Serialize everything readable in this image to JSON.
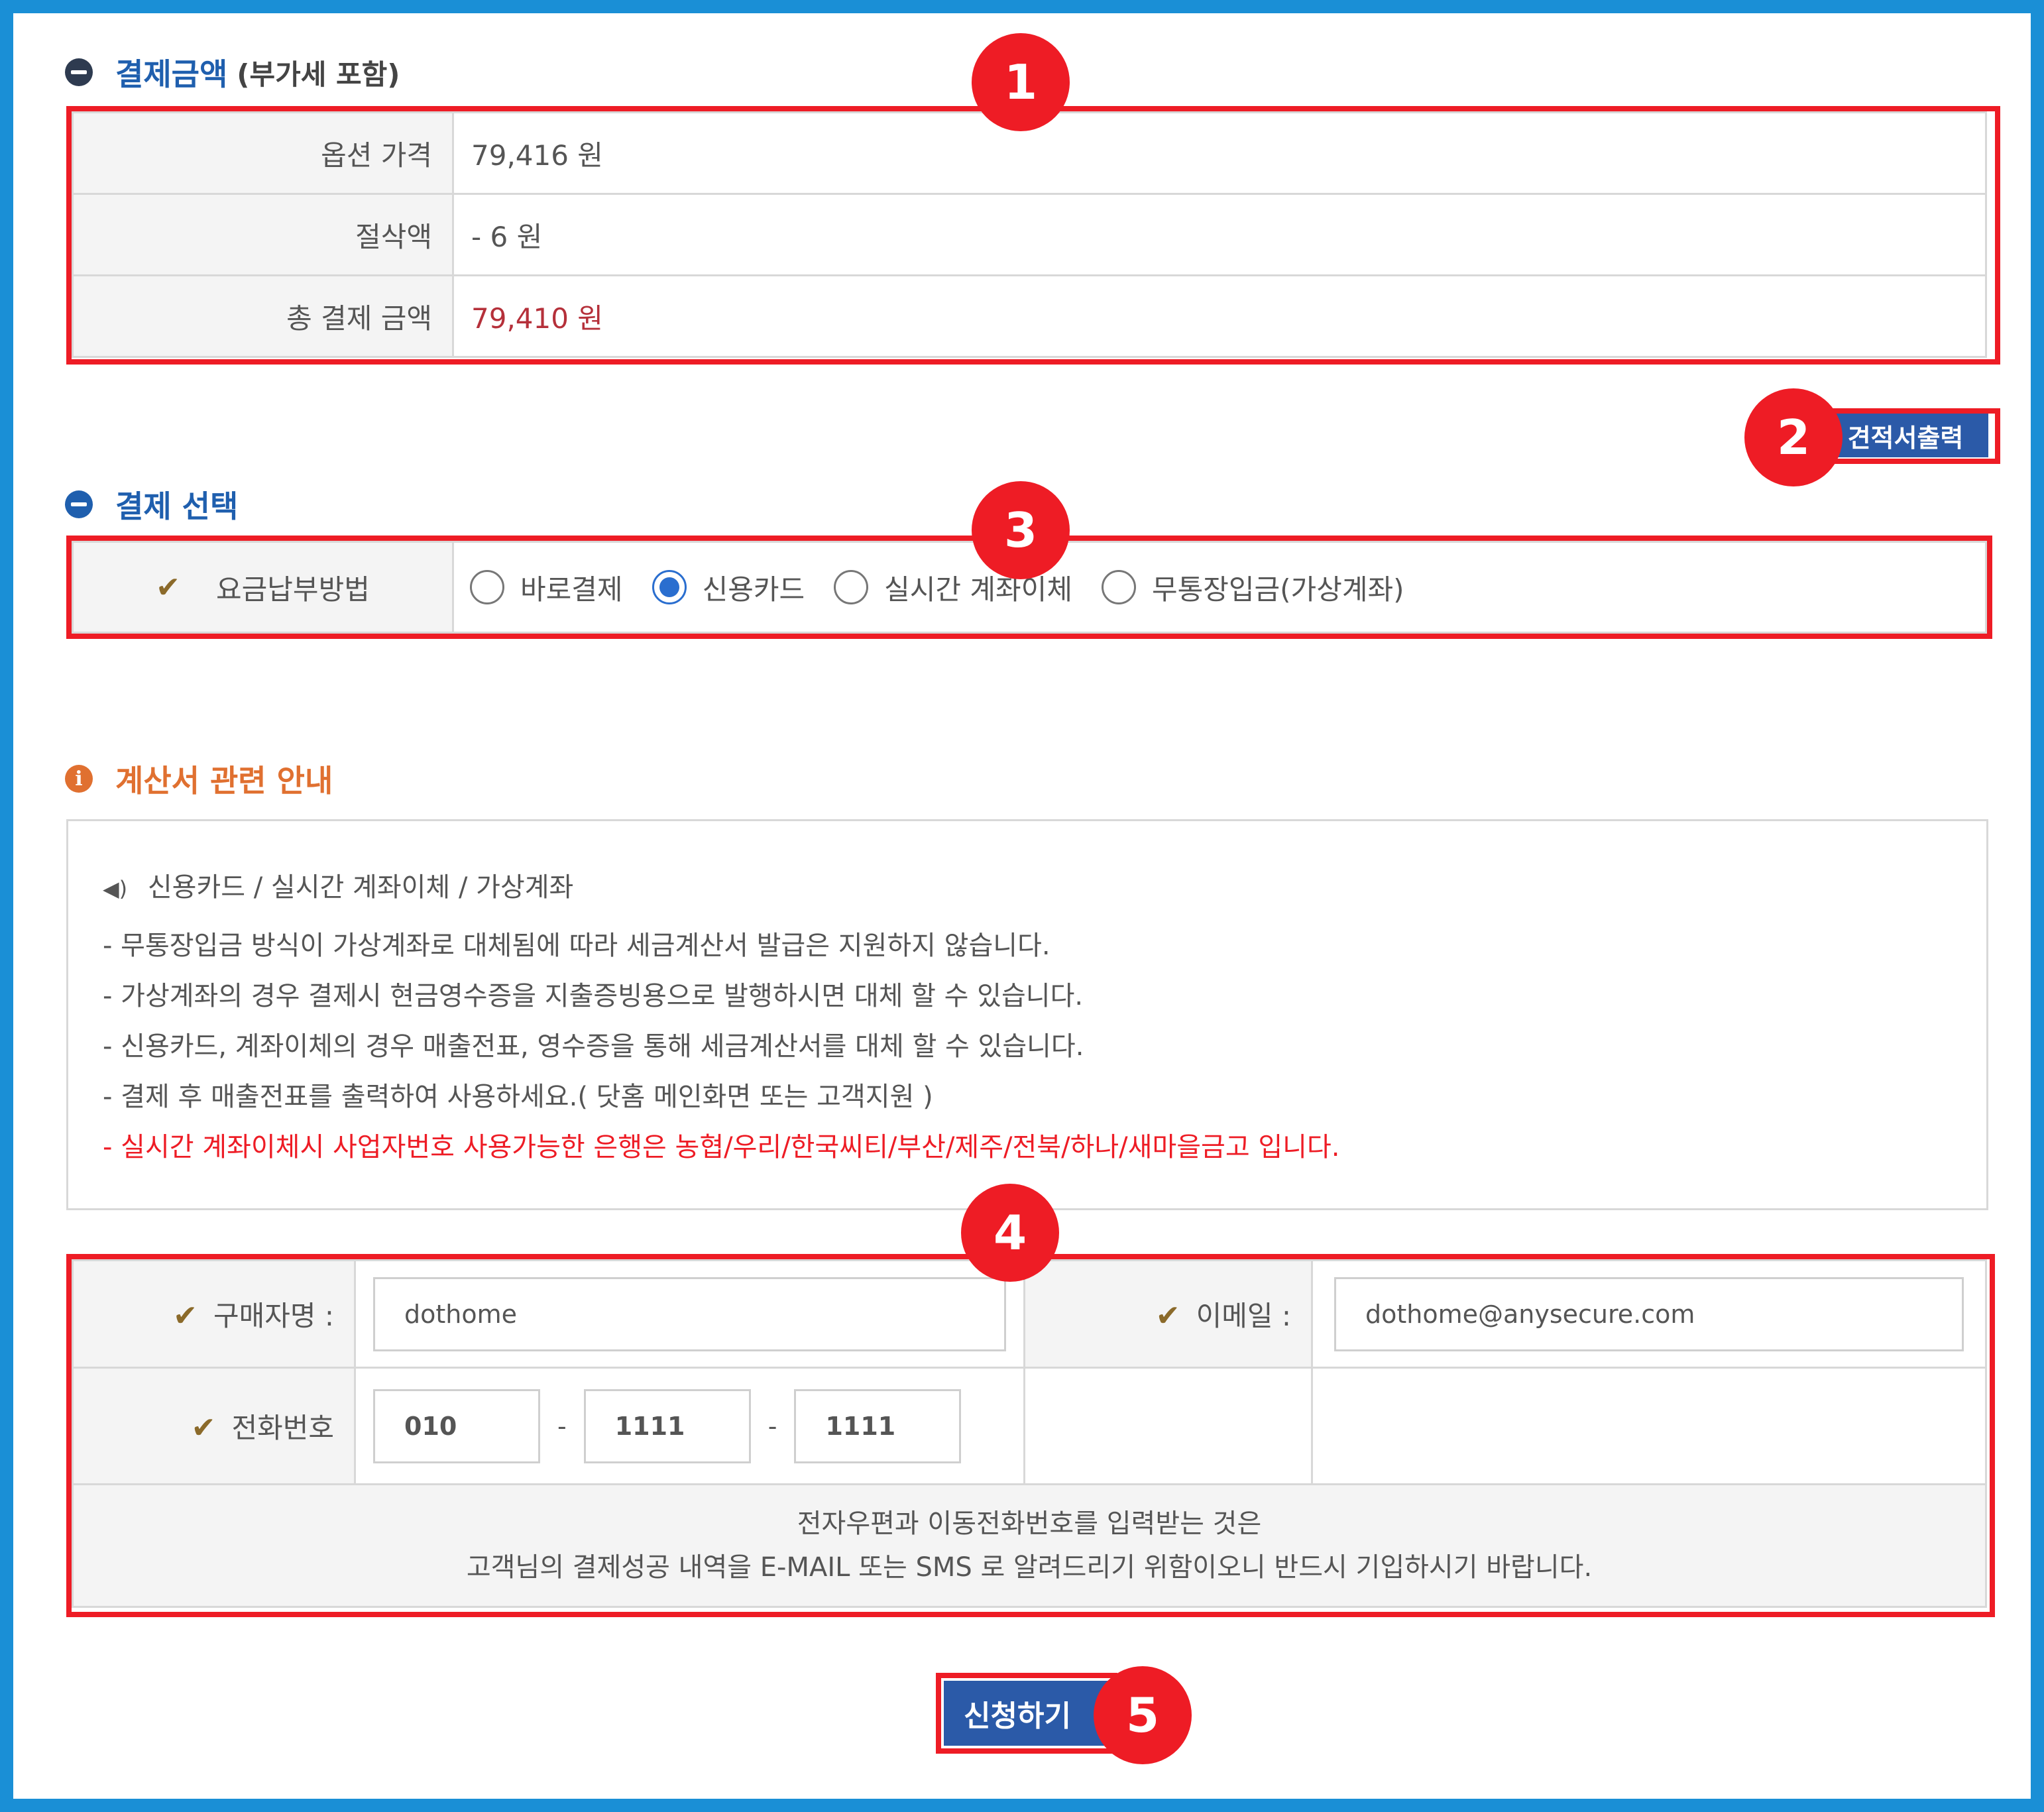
{
  "sections": {
    "payment_amount": {
      "title": "결제금액",
      "subtitle": "(부가세 포함)"
    },
    "payment_select": {
      "title": "결제 선택"
    },
    "invoice_info": {
      "title": "계산서 관련 안내"
    }
  },
  "amounts": [
    {
      "label": "옵션 가격",
      "value": "79,416 원"
    },
    {
      "label": "절삭액",
      "value": "- 6 원"
    },
    {
      "label": "총 결제 금액",
      "value": "79,410 원"
    }
  ],
  "quote_button": "견적서출력",
  "payment": {
    "label": "요금납부방법",
    "options": [
      "바로결제",
      "신용카드",
      "실시간 계좌이체",
      "무통장입금(가상계좌)"
    ],
    "selected": "신용카드"
  },
  "notice": {
    "heading": "신용카드 / 실시간 계좌이체 / 가상계좌",
    "lines": [
      "- 무통장입금 방식이 가상계좌로 대체됨에 따라 세금계산서 발급은 지원하지 않습니다.",
      "- 가상계좌의 경우 결제시 현금영수증을 지출증빙용으로 발행하시면 대체 할 수 있습니다.",
      "- 신용카드, 계좌이체의 경우 매출전표, 영수증을 통해 세금계산서를 대체 할 수 있습니다.",
      "- 결제 후 매출전표를 출력하여 사용하세요.( 닷홈 메인화면 또는 고객지원 )"
    ],
    "highlight": "- 실시간 계좌이체시 사업자번호 사용가능한 은행은 농협/우리/한국씨티/부산/제주/전북/하나/새마을금고 입니다."
  },
  "form": {
    "buyer_label": "구매자명 :",
    "buyer_value": "dothome",
    "email_label": "이메일 :",
    "email_value": "dothome@anysecure.com",
    "phone_label": "전화번호",
    "phone": [
      "010",
      "1111",
      "1111"
    ],
    "phone_sep": "-",
    "note_line1": "전자우편과 이동전화번호를 입력받는 것은",
    "note_line2": "고객님의 결제성공 내역을 E-MAIL 또는 SMS 로 알려드리기 위함이오니 반드시 기입하시기 바랍니다."
  },
  "apply_button": "신청하기",
  "badges": [
    "1",
    "2",
    "3",
    "4",
    "5"
  ],
  "colors": {
    "frame": "#1a8fd6",
    "annotation_red": "#ee1c25",
    "button_blue": "#2b5aa8",
    "total_red": "#b5303a",
    "section_blue": "#1f5fae",
    "info_orange": "#e07030"
  }
}
